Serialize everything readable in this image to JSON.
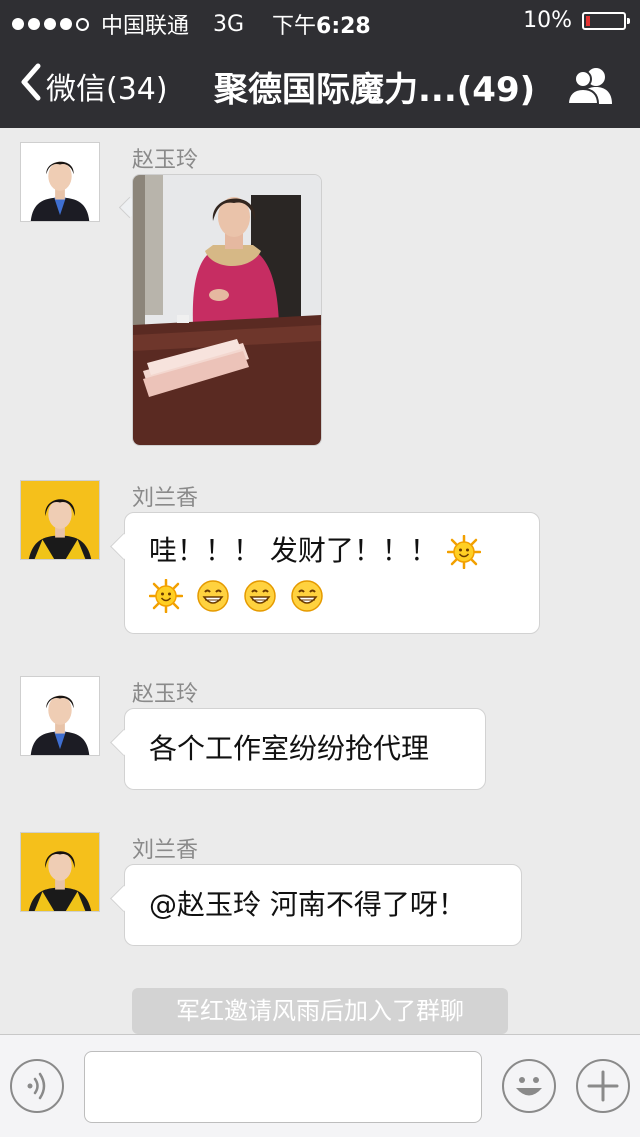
{
  "status_bar": {
    "carrier": "中国联通",
    "network": "3G",
    "time_prefix": "下午",
    "time": "6:28",
    "battery": "10%",
    "battery_level": 0.1,
    "battery_color": "#e33333"
  },
  "nav": {
    "back_label": "微信(34)",
    "title": "聚德国际魔力...(49)",
    "group_icon": "group-members-icon"
  },
  "messages": [
    {
      "sender": "赵玉玲",
      "type": "image"
    },
    {
      "sender": "刘兰香",
      "type": "text",
      "line1": "哇！！！ 发财了！！！",
      "emoji_line1": [
        "sun"
      ],
      "emoji_line2": [
        "sun",
        "grin",
        "grin",
        "grin"
      ]
    },
    {
      "sender": "赵玉玲",
      "type": "text",
      "text": "各个工作室纷纷抢代理"
    },
    {
      "sender": "刘兰香",
      "type": "text",
      "text": "@赵玉玲 河南不得了呀！"
    }
  ],
  "system_message": "军红邀请风雨后加入了群聊",
  "input": {
    "value": "",
    "voice_icon": "voice-icon",
    "emoji_icon": "emoji-icon",
    "plus_icon": "plus-icon"
  },
  "colors": {
    "bar_background": "#2f2f33",
    "chat_background": "#ebebeb",
    "avatar_yellow": "#f5c01b"
  }
}
